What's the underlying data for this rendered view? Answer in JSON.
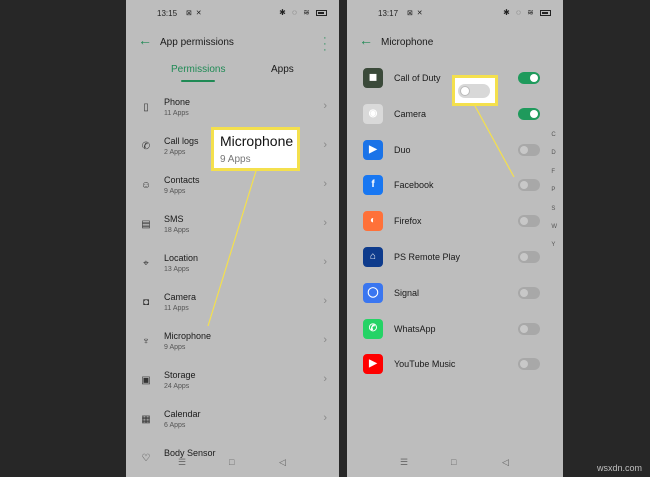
{
  "left": {
    "time": "13:15",
    "title": "App permissions",
    "tabs": {
      "active": "Permissions",
      "inactive": "Apps"
    },
    "items": [
      {
        "name": "Phone",
        "sub": "11 Apps",
        "icon": "phone-icon"
      },
      {
        "name": "Call logs",
        "sub": "2 Apps",
        "icon": "call-log-icon"
      },
      {
        "name": "Contacts",
        "sub": "9 Apps",
        "icon": "contacts-icon"
      },
      {
        "name": "SMS",
        "sub": "18 Apps",
        "icon": "sms-icon"
      },
      {
        "name": "Location",
        "sub": "13 Apps",
        "icon": "location-icon"
      },
      {
        "name": "Camera",
        "sub": "11 Apps",
        "icon": "camera-icon"
      },
      {
        "name": "Microphone",
        "sub": "9 Apps",
        "icon": "microphone-icon"
      },
      {
        "name": "Storage",
        "sub": "24 Apps",
        "icon": "storage-icon"
      },
      {
        "name": "Calendar",
        "sub": "6 Apps",
        "icon": "calendar-icon"
      },
      {
        "name": "Body Sensor",
        "sub": "",
        "icon": "sensor-icon"
      }
    ]
  },
  "callout": {
    "title": "Microphone",
    "sub": "9 Apps"
  },
  "right": {
    "time": "13:17",
    "title": "Microphone",
    "apps": [
      {
        "name": "Call of Duty",
        "on": true,
        "icon": "call-of-duty-icon",
        "color": "#3b4a3a"
      },
      {
        "name": "Camera",
        "on": true,
        "icon": "camera-app-icon",
        "color": "#d9d9d9"
      },
      {
        "name": "Duo",
        "on": false,
        "icon": "duo-icon",
        "color": "#1a73e8"
      },
      {
        "name": "Facebook",
        "on": false,
        "icon": "facebook-icon",
        "color": "#1877f2"
      },
      {
        "name": "Firefox",
        "on": false,
        "icon": "firefox-icon",
        "color": "#ff7139"
      },
      {
        "name": "PS Remote Play",
        "on": false,
        "icon": "ps-remote-play-icon",
        "color": "#0e3b8c"
      },
      {
        "name": "Signal",
        "on": false,
        "icon": "signal-icon",
        "color": "#3a76f0"
      },
      {
        "name": "WhatsApp",
        "on": false,
        "icon": "whatsapp-icon",
        "color": "#25d366"
      },
      {
        "name": "YouTube Music",
        "on": false,
        "icon": "youtube-music-icon",
        "color": "#ff0000"
      }
    ],
    "index_letters": [
      "C",
      "D",
      "F",
      "P",
      "S",
      "W",
      "Y"
    ]
  },
  "colors": {
    "accent": "#1f8a55",
    "highlight": "#f4e04d"
  },
  "watermark": "wsxdn.com"
}
